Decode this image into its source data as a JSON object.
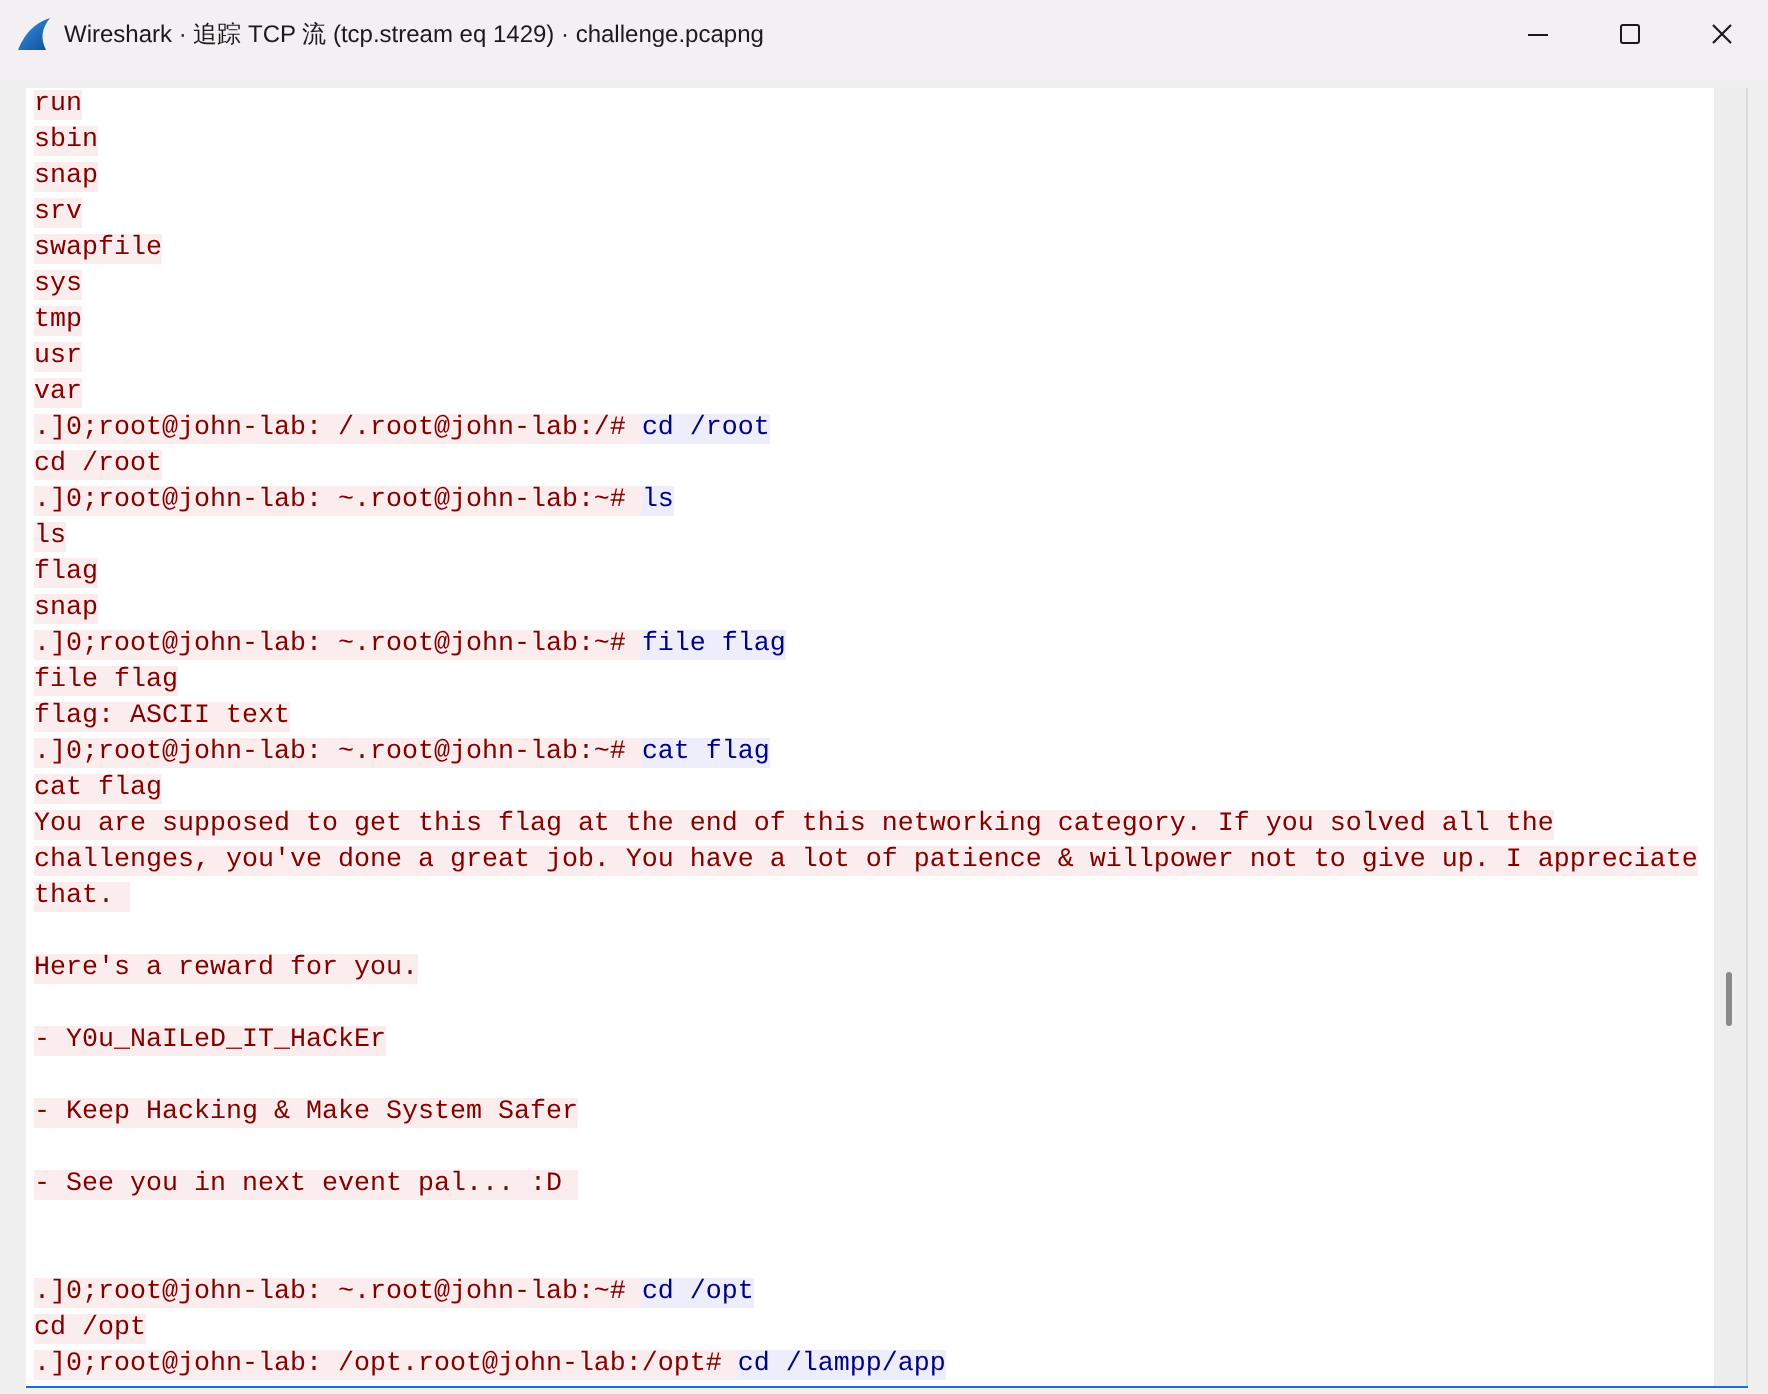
{
  "window": {
    "title": "Wireshark · 追踪 TCP 流 (tcp.stream eq 1429) · challenge.pcapng"
  },
  "stream": {
    "lines": [
      {
        "kind": "text",
        "segments": [
          {
            "kind": "server",
            "text": "run"
          }
        ]
      },
      {
        "kind": "text",
        "segments": [
          {
            "kind": "server",
            "text": "sbin"
          }
        ]
      },
      {
        "kind": "text",
        "segments": [
          {
            "kind": "server",
            "text": "snap"
          }
        ]
      },
      {
        "kind": "text",
        "segments": [
          {
            "kind": "server",
            "text": "srv"
          }
        ]
      },
      {
        "kind": "text",
        "segments": [
          {
            "kind": "server",
            "text": "swapfile"
          }
        ]
      },
      {
        "kind": "text",
        "segments": [
          {
            "kind": "server",
            "text": "sys"
          }
        ]
      },
      {
        "kind": "text",
        "segments": [
          {
            "kind": "server",
            "text": "tmp"
          }
        ]
      },
      {
        "kind": "text",
        "segments": [
          {
            "kind": "server",
            "text": "usr"
          }
        ]
      },
      {
        "kind": "text",
        "segments": [
          {
            "kind": "server",
            "text": "var"
          }
        ]
      },
      {
        "kind": "text",
        "segments": [
          {
            "kind": "server",
            "text": ".]0;root@john-lab: /.root@john-lab:/# "
          },
          {
            "kind": "client",
            "text": "cd /root"
          }
        ]
      },
      {
        "kind": "text",
        "segments": [
          {
            "kind": "server",
            "text": "cd /root"
          }
        ]
      },
      {
        "kind": "text",
        "segments": [
          {
            "kind": "server",
            "text": ".]0;root@john-lab: ~.root@john-lab:~# "
          },
          {
            "kind": "client",
            "text": "ls"
          }
        ]
      },
      {
        "kind": "text",
        "segments": [
          {
            "kind": "server",
            "text": "ls"
          }
        ]
      },
      {
        "kind": "text",
        "segments": [
          {
            "kind": "server",
            "text": "flag"
          }
        ]
      },
      {
        "kind": "text",
        "segments": [
          {
            "kind": "server",
            "text": "snap"
          }
        ]
      },
      {
        "kind": "text",
        "segments": [
          {
            "kind": "server",
            "text": ".]0;root@john-lab: ~.root@john-lab:~# "
          },
          {
            "kind": "client",
            "text": "file flag"
          }
        ]
      },
      {
        "kind": "text",
        "segments": [
          {
            "kind": "server",
            "text": "file flag"
          }
        ]
      },
      {
        "kind": "text",
        "segments": [
          {
            "kind": "server",
            "text": "flag: ASCII text"
          }
        ]
      },
      {
        "kind": "text",
        "segments": [
          {
            "kind": "server",
            "text": ".]0;root@john-lab: ~.root@john-lab:~# "
          },
          {
            "kind": "client",
            "text": "cat flag"
          }
        ]
      },
      {
        "kind": "text",
        "segments": [
          {
            "kind": "server",
            "text": "cat flag"
          }
        ]
      },
      {
        "kind": "text",
        "segments": [
          {
            "kind": "server",
            "text": "You are supposed to get this flag at the end of this networking category. If you solved all the"
          }
        ]
      },
      {
        "kind": "text",
        "segments": [
          {
            "kind": "server",
            "text": "challenges, you've done a great job. You have a lot of patience & willpower not to give up. I appreciate"
          }
        ]
      },
      {
        "kind": "text",
        "segments": [
          {
            "kind": "server",
            "text": "that. "
          }
        ]
      },
      {
        "kind": "blank"
      },
      {
        "kind": "text",
        "segments": [
          {
            "kind": "server",
            "text": "Here's a reward for you."
          }
        ]
      },
      {
        "kind": "blank"
      },
      {
        "kind": "text",
        "segments": [
          {
            "kind": "server",
            "text": "- Y0u_NaILeD_IT_HaCkEr"
          }
        ]
      },
      {
        "kind": "blank"
      },
      {
        "kind": "text",
        "segments": [
          {
            "kind": "server",
            "text": "- Keep Hacking & Make System Safer"
          }
        ]
      },
      {
        "kind": "blank"
      },
      {
        "kind": "text",
        "segments": [
          {
            "kind": "server",
            "text": "- See you in next event pal... :D "
          }
        ]
      },
      {
        "kind": "blank"
      },
      {
        "kind": "blank"
      },
      {
        "kind": "text",
        "segments": [
          {
            "kind": "server",
            "text": ".]0;root@john-lab: ~.root@john-lab:~# "
          },
          {
            "kind": "client",
            "text": "cd /opt"
          }
        ]
      },
      {
        "kind": "text",
        "segments": [
          {
            "kind": "server",
            "text": "cd /opt"
          }
        ]
      },
      {
        "kind": "text",
        "segments": [
          {
            "kind": "server",
            "text": ".]0;root@john-lab: /opt.root@john-lab:/opt# "
          },
          {
            "kind": "client",
            "text": "cd /lampp/app"
          }
        ]
      }
    ]
  }
}
